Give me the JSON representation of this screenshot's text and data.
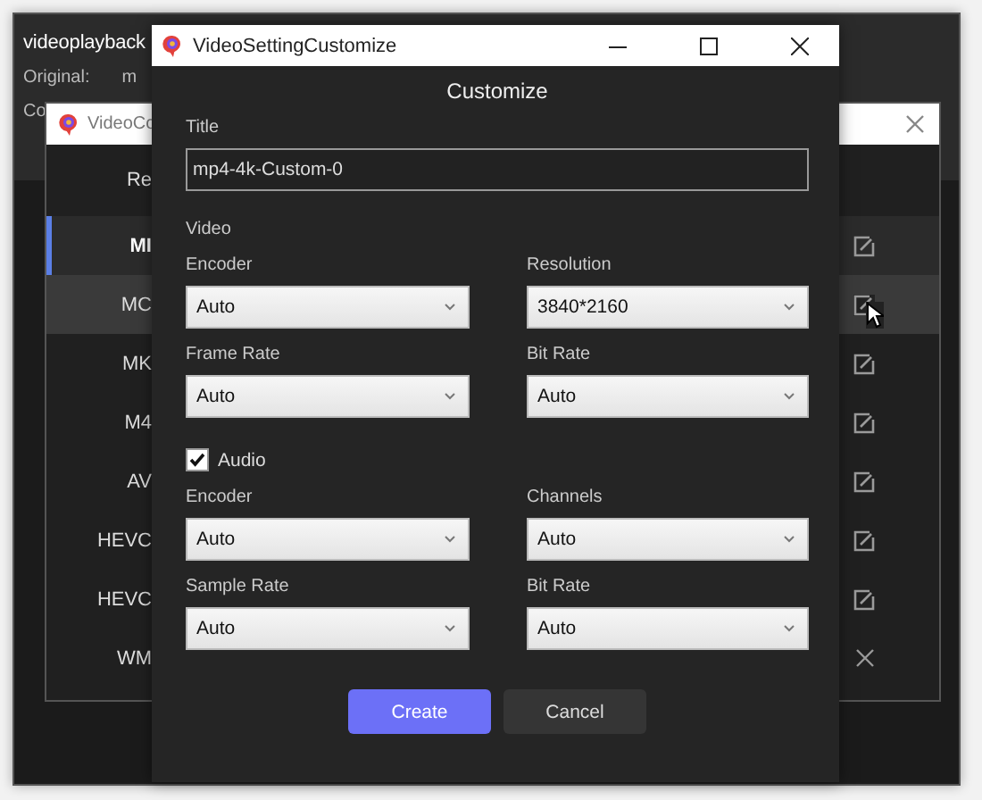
{
  "background_window": {
    "title": "videoplayback",
    "original_label": "Original:",
    "original_value": "m",
    "converted_label": "Co"
  },
  "list_dialog": {
    "title": "VideoCo",
    "header": "Re",
    "rows": [
      {
        "label": "MI",
        "selected": true,
        "hovered": false,
        "kind": "edit"
      },
      {
        "label": "MC",
        "selected": false,
        "hovered": true,
        "kind": "edit"
      },
      {
        "label": "MK",
        "selected": false,
        "hovered": false,
        "kind": "edit"
      },
      {
        "label": "M4",
        "selected": false,
        "hovered": false,
        "kind": "edit"
      },
      {
        "label": "AV",
        "selected": false,
        "hovered": false,
        "kind": "edit"
      },
      {
        "label": "HEVC",
        "selected": false,
        "hovered": false,
        "kind": "edit"
      },
      {
        "label": "HEVC",
        "selected": false,
        "hovered": false,
        "kind": "edit"
      },
      {
        "label": "WM",
        "selected": false,
        "hovered": false,
        "kind": "delete"
      }
    ]
  },
  "customize_dialog": {
    "title": "VideoSettingCustomize",
    "heading": "Customize",
    "title_label": "Title",
    "title_value": "mp4-4k-Custom-0",
    "video_section": "Video",
    "video_fields": [
      {
        "label": "Encoder",
        "value": "Auto"
      },
      {
        "label": "Resolution",
        "value": "3840*2160"
      },
      {
        "label": "Frame Rate",
        "value": "Auto"
      },
      {
        "label": "Bit Rate",
        "value": "Auto"
      }
    ],
    "audio": {
      "label": "Audio",
      "checked": true
    },
    "audio_fields": [
      {
        "label": "Encoder",
        "value": "Auto"
      },
      {
        "label": "Channels",
        "value": "Auto"
      },
      {
        "label": "Sample Rate",
        "value": "Auto"
      },
      {
        "label": "Bit Rate",
        "value": "Auto"
      }
    ],
    "buttons": [
      {
        "label": "Create",
        "kind": "primary"
      },
      {
        "label": "Cancel",
        "kind": "secondary"
      }
    ]
  }
}
